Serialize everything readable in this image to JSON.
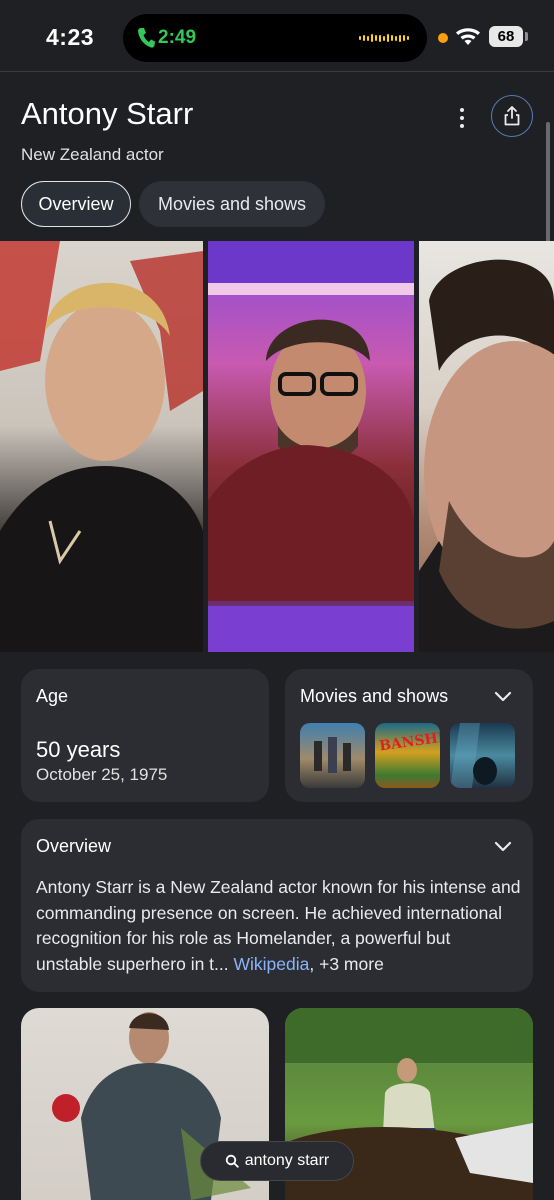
{
  "status_bar": {
    "time": "4:23",
    "call_timer": "2:49",
    "battery": "68"
  },
  "header": {
    "title": "Antony Starr",
    "subtitle": "New Zealand actor"
  },
  "tabs": [
    {
      "label": "Overview",
      "active": true
    },
    {
      "label": "Movies and shows",
      "active": false
    }
  ],
  "age_card": {
    "label": "Age",
    "value": "50 years",
    "birth_date": "October 25, 1975"
  },
  "movies_card": {
    "label": "Movies and shows",
    "thumbnails": [
      "the-boys-poster",
      "banshee-poster",
      "third-poster"
    ],
    "banshee_logo_text": "BANSHEE"
  },
  "overview_card": {
    "label": "Overview",
    "text": "Antony Starr is a New Zealand actor known for his intense and commanding presence on screen. He achieved international recognition for his role as Homelander, a powerful but unstable superhero in t",
    "ellipsis": "...",
    "source": "Wikipedia",
    "more": ", +3 more"
  },
  "search_pill": {
    "query": "antony starr"
  },
  "colors": {
    "background": "#1f2024",
    "card": "#2b2d33",
    "link": "#8ab4f8",
    "call_green": "#34c759"
  }
}
